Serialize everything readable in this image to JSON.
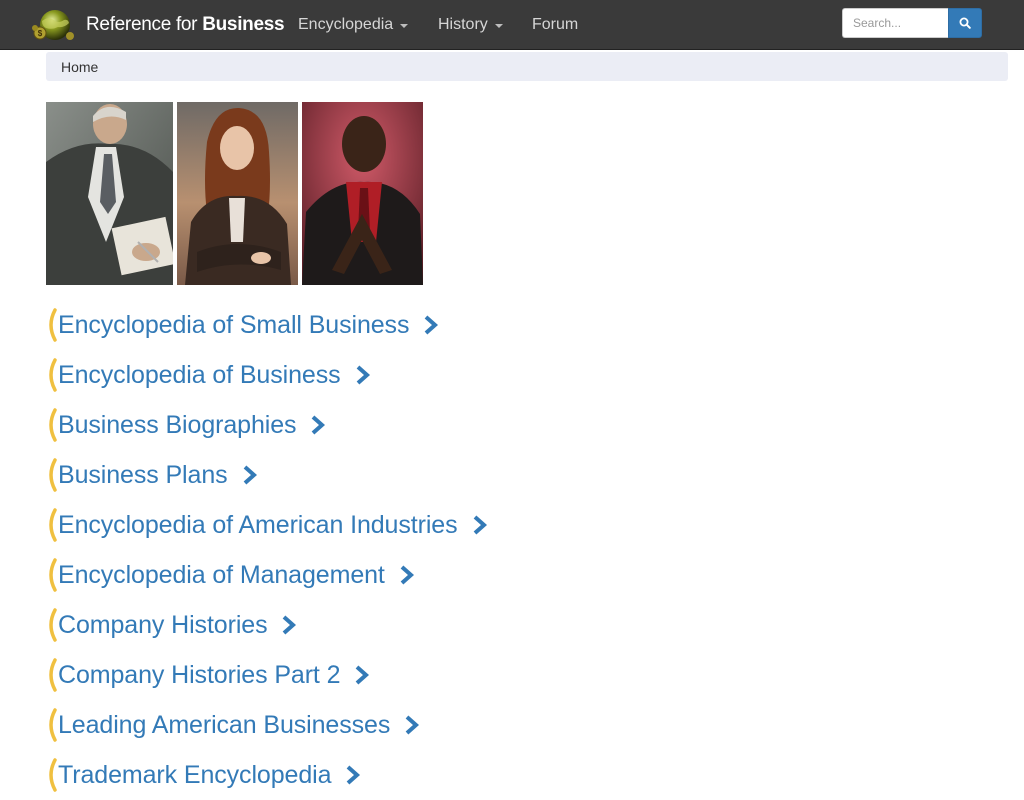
{
  "navbar": {
    "brand_regular": "Reference for ",
    "brand_bold": "Business",
    "brand_icon": "globe-dollar-logo",
    "items": [
      {
        "label": "Encyclopedia",
        "has_dropdown": true
      },
      {
        "label": "History",
        "has_dropdown": true
      },
      {
        "label": "Forum",
        "has_dropdown": false
      }
    ],
    "search": {
      "placeholder": "Search...",
      "value": "",
      "button_icon": "search-icon"
    }
  },
  "breadcrumb": {
    "items": [
      "Home"
    ]
  },
  "photos": [
    {
      "subject": "businessman-writing"
    },
    {
      "subject": "businesswoman-arms-crossed"
    },
    {
      "subject": "businessman-hands-steepled"
    }
  ],
  "categories": [
    "Encyclopedia of Small Business",
    "Encyclopedia of Business",
    "Business Biographies",
    "Business Plans",
    "Encyclopedia of American Industries",
    "Encyclopedia of Management",
    "Company Histories",
    "Company Histories Part 2",
    "Leading American Businesses",
    "Trademark Encyclopedia"
  ],
  "colors": {
    "navbar_bg": "#3a3a3a",
    "link_blue": "#337ab7",
    "bracket_gold": "#f0c040",
    "breadcrumb_bg": "#ebedf5"
  }
}
